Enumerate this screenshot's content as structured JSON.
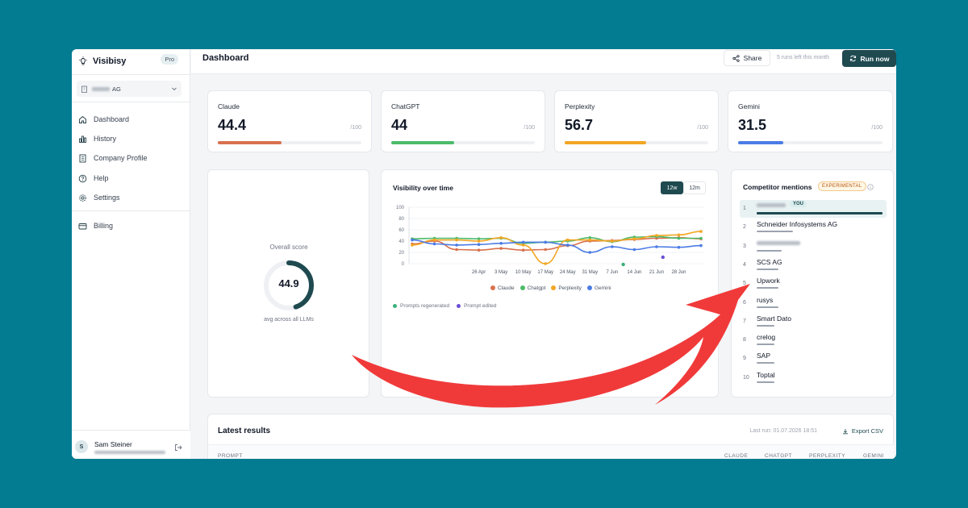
{
  "app": {
    "name": "Visibisy",
    "plan_badge": "Pro"
  },
  "company": {
    "name_suffix": "AG"
  },
  "nav": [
    {
      "label": "Dashboard",
      "icon": "home-icon"
    },
    {
      "label": "History",
      "icon": "bar-chart-icon"
    },
    {
      "label": "Company Profile",
      "icon": "building-icon"
    },
    {
      "label": "Help",
      "icon": "help-circle-icon"
    },
    {
      "label": "Settings",
      "icon": "gear-icon"
    },
    {
      "label": "Billing",
      "icon": "credit-card-icon"
    }
  ],
  "user": {
    "initial": "S",
    "name": "Sam Steiner"
  },
  "header": {
    "title": "Dashboard",
    "share_label": "Share",
    "runs_left": "5 runs left this month",
    "run_label": "Run now"
  },
  "llm_scores": [
    {
      "name": "Claude",
      "score": "44.4",
      "max": "/100",
      "value": 44.4,
      "color": "#d9714e"
    },
    {
      "name": "ChatGPT",
      "score": "44",
      "max": "/100",
      "value": 44,
      "color": "#4cbb6a"
    },
    {
      "name": "Perplexity",
      "score": "56.7",
      "max": "/100",
      "value": 56.7,
      "color": "#f2a623"
    },
    {
      "name": "Gemini",
      "score": "31.5",
      "max": "/100",
      "value": 31.5,
      "color": "#4b7be5"
    }
  ],
  "overall": {
    "label": "Overall score",
    "score": "44.9",
    "value": 44.9,
    "sub": "avg across all LLMs"
  },
  "chart": {
    "title": "Visibility over time",
    "ranges": [
      "12w",
      "12m"
    ],
    "active_range": "12w",
    "event_legend": {
      "regenerated": "Prompts regenerated",
      "edited": "Prompt edited",
      "regenerated_color": "#3ab17a",
      "edited_color": "#6a4fd8"
    }
  },
  "chart_data": {
    "type": "line",
    "x": [
      "19 Apr",
      "20 Apr",
      "21 Apr",
      "26 Apr",
      "3 May",
      "10 May",
      "17 May",
      "24 May",
      "31 May",
      "7 Jun",
      "14 Jun",
      "21 Jun",
      "28 Jun",
      "2 Jul"
    ],
    "xticks": [
      "26 Apr",
      "3 May",
      "10 May",
      "17 May",
      "24 May",
      "31 May",
      "7 Jun",
      "14 Jun",
      "21 Jun",
      "28 Jun"
    ],
    "yticks": [
      0,
      20,
      40,
      60,
      80,
      100
    ],
    "ylim": [
      0,
      100
    ],
    "series": [
      {
        "name": "Claude",
        "color": "#d9714e",
        "values": [
          35,
          40,
          25,
          24,
          27,
          24,
          25,
          32,
          40,
          41,
          43,
          45,
          46,
          44
        ]
      },
      {
        "name": "Chatgpt",
        "color": "#4cbb6a",
        "values": [
          44,
          45,
          45,
          44,
          45,
          36,
          38,
          40,
          46,
          39,
          47,
          48,
          45,
          45
        ]
      },
      {
        "name": "Perplexity",
        "color": "#f2a623",
        "values": [
          33,
          42,
          42,
          40,
          46,
          33,
          0,
          42,
          42,
          40,
          44,
          50,
          51,
          57
        ]
      },
      {
        "name": "Gemini",
        "color": "#4b7be5",
        "values": [
          42,
          35,
          33,
          34,
          36,
          38,
          38,
          33,
          20,
          30,
          25,
          30,
          29,
          32
        ]
      }
    ],
    "events": [
      {
        "type": "regenerated",
        "x": "10 Jun"
      },
      {
        "type": "edited",
        "x": "23 Jun"
      }
    ]
  },
  "competitors": {
    "title": "Competitor mentions",
    "badge": "EXPERIMENTAL",
    "you_label": "YOU",
    "items": [
      {
        "rank": "1",
        "name": "",
        "you": true,
        "share": 1.0
      },
      {
        "rank": "2",
        "name": "Schneider Infosystems AG",
        "share": 0.29
      },
      {
        "rank": "3",
        "name": "",
        "share": 0.2
      },
      {
        "rank": "4",
        "name": "SCS AG",
        "share": 0.17
      },
      {
        "rank": "5",
        "name": "Upwork",
        "share": 0.17
      },
      {
        "rank": "6",
        "name": "rusys",
        "share": 0.17
      },
      {
        "rank": "7",
        "name": "Smart Dato",
        "share": 0.14
      },
      {
        "rank": "8",
        "name": "crelog",
        "share": 0.14
      },
      {
        "rank": "9",
        "name": "SAP",
        "share": 0.14
      },
      {
        "rank": "10",
        "name": "Toptal",
        "share": 0.14
      }
    ]
  },
  "latest": {
    "title": "Latest results",
    "last_run": "Last run: 01.07.2026 18:51",
    "export_label": "Export CSV",
    "columns": [
      "PROMPT",
      "CLAUDE",
      "CHATGPT",
      "PERPLEXITY",
      "GEMINI"
    ]
  }
}
